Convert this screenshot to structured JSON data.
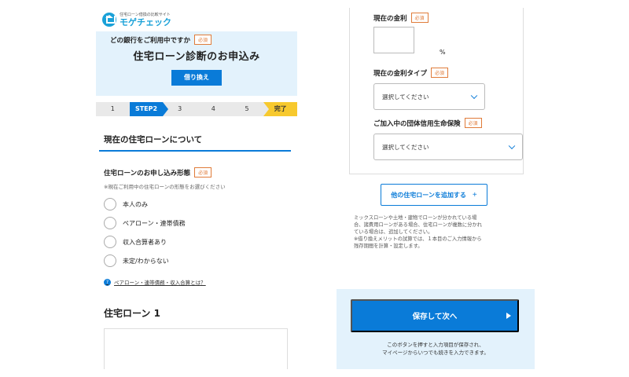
{
  "logo": {
    "sub": "住宅ローン借換の比較サイト",
    "main": "モゲチェック",
    "icon": "house-icon"
  },
  "hero": {
    "title": "住宅ローン診断のお申込み",
    "button": "借り換え"
  },
  "steps": [
    "1",
    "STEP2",
    "3",
    "4",
    "5",
    "完了"
  ],
  "section": {
    "title": "現在の住宅ローンについて"
  },
  "question": {
    "label": "住宅ローンのお申し込み形態",
    "badge": "必須",
    "note": "※現在ご利用中の住宅ローンの形態をお選びください",
    "options": [
      "本人のみ",
      "ペアローン・連帯債務",
      "収入合算者あり",
      "未定/わからない"
    ]
  },
  "help": {
    "text": "ペアローン・連帯債務・収入合算とは？",
    "icon": "question-icon"
  },
  "loan": {
    "title": "住宅ローン 1",
    "question": "どの銀行をご利用中ですか",
    "badge": "必須"
  },
  "right": {
    "rate_label": "現在の金利",
    "rate_badge": "必須",
    "rate_unit": "%",
    "rate_value": "",
    "type_label": "現在の金利タイプ",
    "type_badge": "必須",
    "type_placeholder": "選択してください",
    "insurance_label": "ご加入中の団体信用生命保険",
    "insurance_badge": "必須",
    "insurance_placeholder": "選択してください",
    "add_button": "他の住宅ローンを追加する",
    "add_plus": "+",
    "info": [
      "ミックスローンや土地・建物でローンが分かれている場",
      "合、諸費用ローンがある場合、住宅ローンが複数に分かれ",
      "ている場合は、追加してください。",
      "※借り換えメリットの試算では、１本目のご入力情報から",
      "残存期間を計算・設定します。"
    ],
    "save_button": "保存して次へ",
    "save_note_1": "このボタンを押すと入力項目が保存され、",
    "save_note_2": "マイページからいつでも続きを入力できます。"
  },
  "colors": {
    "primary": "#0a7bd8",
    "light_bg": "#e3f2fc",
    "badge": "#e07b39",
    "done": "#f7c92e"
  }
}
